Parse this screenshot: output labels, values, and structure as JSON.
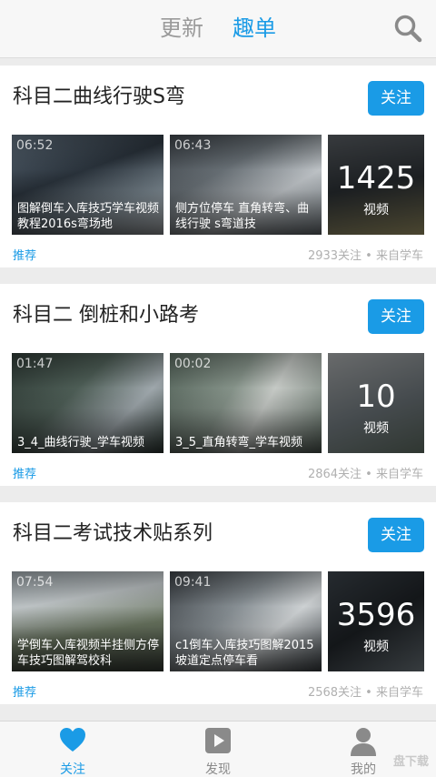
{
  "header": {
    "tabs": [
      {
        "label": "更新",
        "active": false
      },
      {
        "label": "趣单",
        "active": true
      }
    ],
    "search_icon": "search-icon"
  },
  "cards": [
    {
      "title": "科目二曲线行驶S弯",
      "follow_label": "关注",
      "videos": [
        {
          "duration": "06:52",
          "title": "图解倒车入库技巧学车视频教程2016s弯场地"
        },
        {
          "duration": "06:43",
          "title": "侧方位停车 直角转弯、曲线行驶 s弯道技"
        }
      ],
      "more": {
        "count": "1425",
        "unit": "视频"
      },
      "tag": "推荐",
      "meta": "2933关注 • 来自学车"
    },
    {
      "title": "科目二 倒桩和小路考",
      "follow_label": "关注",
      "videos": [
        {
          "duration": "01:47",
          "title": "3_4_曲线行驶_学车视频"
        },
        {
          "duration": "00:02",
          "title": "3_5_直角转弯_学车视频"
        }
      ],
      "more": {
        "count": "10",
        "unit": "视频"
      },
      "tag": "推荐",
      "meta": "2864关注 • 来自学车"
    },
    {
      "title": "科目二考试技术贴系列",
      "follow_label": "关注",
      "videos": [
        {
          "duration": "07:54",
          "title": "学倒车入库视频半挂侧方停车技巧图解驾校科"
        },
        {
          "duration": "09:41",
          "title": "c1倒车入库技巧图解2015坡道定点停车看"
        }
      ],
      "more": {
        "count": "3596",
        "unit": "视频"
      },
      "tag": "推荐",
      "meta": "2568关注 • 来自学车"
    }
  ],
  "bottom_nav": [
    {
      "label": "关注",
      "icon": "heart-icon",
      "active": true
    },
    {
      "label": "发现",
      "icon": "play-icon",
      "active": false
    },
    {
      "label": "我的",
      "icon": "user-icon",
      "active": false
    }
  ],
  "watermark": "盘下载",
  "colors": {
    "accent": "#1a9be6",
    "background": "#ececec",
    "card": "#ffffff"
  }
}
